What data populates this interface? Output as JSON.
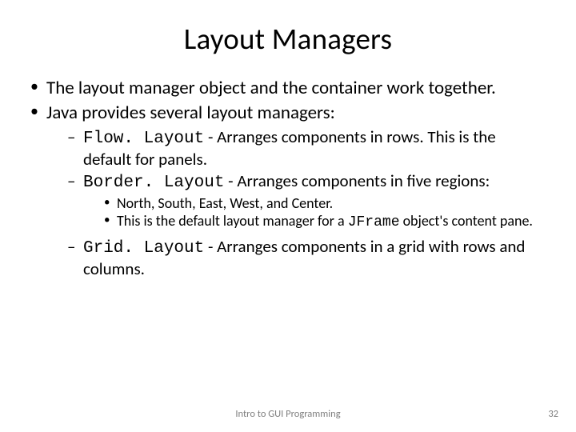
{
  "title": "Layout Managers",
  "bullets": {
    "b1": "The layout manager object and the container work together.",
    "b2": "Java provides several layout managers:",
    "flow_code": "Flow. Layout",
    "flow_rest": " - Arranges components in rows. This is the default for panels.",
    "border_code": "Border. Layout",
    "border_rest": " - Arranges components in five regions:",
    "border_sub1": "North, South, East, West, and Center.",
    "border_sub2a": "This is the default layout manager for a ",
    "border_sub2_code": "JFrame",
    "border_sub2b": " object's content pane.",
    "grid_code": "Grid. Layout",
    "grid_rest": " - Arranges components in a grid with rows and columns."
  },
  "footer": {
    "center": "Intro to GUI Programming",
    "page": "32"
  }
}
